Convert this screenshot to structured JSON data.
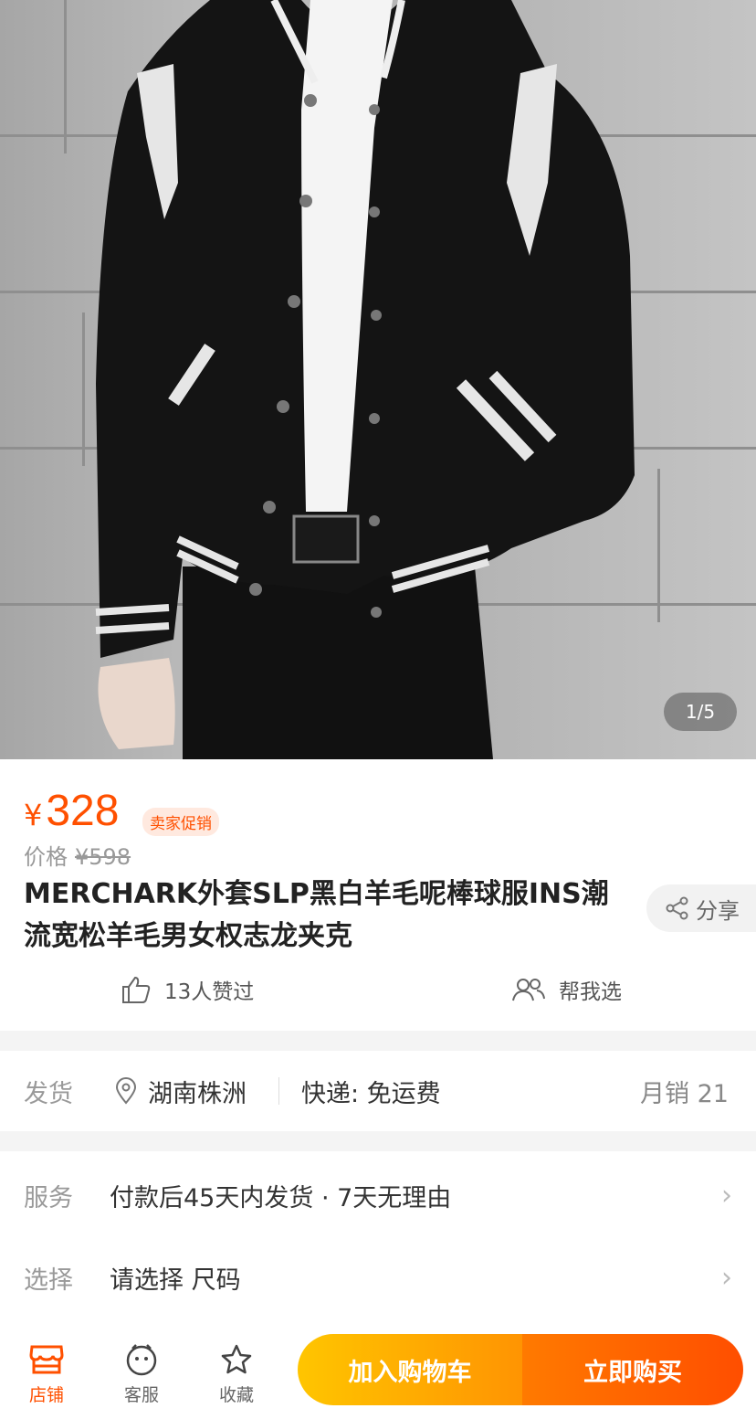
{
  "gallery": {
    "counter": "1/5"
  },
  "price": {
    "currency": "¥",
    "current": "328",
    "badge": "卖家促销",
    "orig_label": "价格",
    "orig_value": "¥598"
  },
  "product": {
    "title": "MERCHARK外套SLP黑白羊毛呢棒球服INS潮流宽松羊毛男女权志龙夹克"
  },
  "actions": {
    "share": "分享",
    "likes": "13人赞过",
    "help": "帮我选"
  },
  "shipping": {
    "label": "发货",
    "location": "湖南株洲",
    "express": "快递: 免运费",
    "monthly_sales": "月销 21"
  },
  "service": {
    "label": "服务",
    "value": "付款后45天内发货 · 7天无理由"
  },
  "select": {
    "label": "选择",
    "value": "请选择 尺码"
  },
  "bottom_bar": {
    "store": "店铺",
    "support": "客服",
    "favorite": "收藏",
    "add_to_cart": "加入购物车",
    "buy_now": "立即购买"
  },
  "colors": {
    "accent": "#ff5000",
    "cart_gradient": [
      "#ffc500",
      "#ff9402"
    ],
    "buy_gradient": [
      "#ff7a00",
      "#ff4e00"
    ]
  }
}
